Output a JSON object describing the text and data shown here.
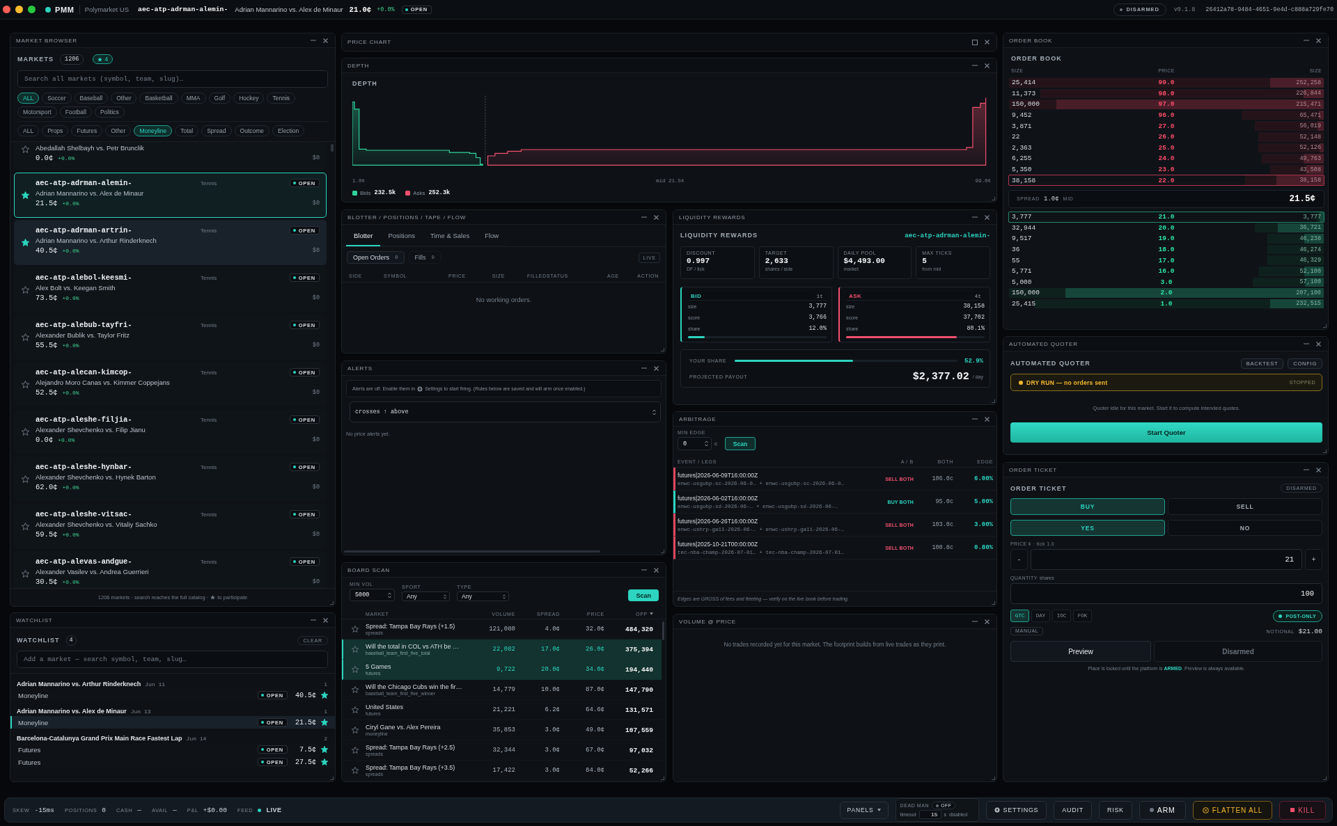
{
  "top_bar": {
    "app_name": "PMM",
    "venue": "Polymarket US",
    "symbol": "aec-atp-adrman-alemin-",
    "title": "Adrian Mannarino vs. Alex de Minaur",
    "price": "21.0¢",
    "change": "+0.0%",
    "status": "OPEN",
    "mode": "DISARMED",
    "version": "v0.1.8",
    "session_id": "26412a78-9484-4651-9e4d-c888a729fe70"
  },
  "market_browser": {
    "title": "MARKET BROWSER",
    "label": "MARKETS",
    "count": "1206",
    "favorites": "4",
    "search": {
      "placeholder": "Search all markets (symbol, team, slug)…"
    },
    "sport_filters": [
      {
        "label": "ALL",
        "selected": true
      },
      {
        "label": "Soccer",
        "selected": false
      },
      {
        "label": "Baseball",
        "selected": false
      },
      {
        "label": "Other",
        "selected": false
      },
      {
        "label": "Basketball",
        "selected": false
      },
      {
        "label": "MMA",
        "selected": false
      },
      {
        "label": "Golf",
        "selected": false
      },
      {
        "label": "Hockey",
        "selected": false
      },
      {
        "label": "Tennis",
        "selected": false
      },
      {
        "label": "Motorsport",
        "selected": false
      },
      {
        "label": "Football",
        "selected": false
      },
      {
        "label": "Politics",
        "selected": false
      }
    ],
    "type_filters": [
      {
        "label": "ALL",
        "selected": false
      },
      {
        "label": "Props",
        "selected": false
      },
      {
        "label": "Futures",
        "selected": false
      },
      {
        "label": "Other",
        "selected": false
      },
      {
        "label": "Moneyline",
        "selected": true
      },
      {
        "label": "Total",
        "selected": false
      },
      {
        "label": "Spread",
        "selected": false
      },
      {
        "label": "Outcome",
        "selected": false
      },
      {
        "label": "Election",
        "selected": false
      }
    ],
    "markets": [
      {
        "title": "Abedallah Shelbayh vs. Petr Brunclik",
        "price": "0.0¢",
        "change": "+0.0%",
        "volume": "$0",
        "starred": false,
        "selected": false,
        "highlighted": false
      },
      {
        "symbol": "aec-atp-adrman-alemin-",
        "sport": "Tennis",
        "status": "OPEN",
        "title": "Adrian Mannarino vs. Alex de Minaur",
        "price": "21.5¢",
        "change": "+0.0%",
        "volume": "$0",
        "starred": true,
        "selected": true,
        "highlighted": false
      },
      {
        "symbol": "aec-atp-adrman-artrin-",
        "sport": "Tennis",
        "status": "OPEN",
        "title": "Adrian Mannarino vs. Arthur Rinderknech",
        "price": "40.5¢",
        "change": "+0.0%",
        "volume": "$0",
        "starred": true,
        "selected": false,
        "highlighted": true
      },
      {
        "symbol": "aec-atp-alebol-keesmi-",
        "sport": "Tennis",
        "status": "OPEN",
        "title": "Alex Bolt vs. Keegan Smith",
        "price": "73.5¢",
        "change": "+0.0%",
        "volume": "$0",
        "starred": false,
        "selected": false,
        "highlighted": false
      },
      {
        "symbol": "aec-atp-alebub-tayfri-",
        "sport": "Tennis",
        "status": "OPEN",
        "title": "Alexander Bublik vs. Taylor Fritz",
        "price": "55.5¢",
        "change": "+0.0%",
        "volume": "$0",
        "starred": false,
        "selected": false,
        "highlighted": false
      },
      {
        "symbol": "aec-atp-alecan-kimcop-",
        "sport": "Tennis",
        "status": "OPEN",
        "title": "Alejandro Moro Canas vs. Kimmer Coppejans",
        "price": "52.5¢",
        "change": "+0.0%",
        "volume": "$0",
        "starred": false,
        "selected": false,
        "highlighted": false
      },
      {
        "symbol": "aec-atp-aleshe-filjia-",
        "sport": "Tennis",
        "status": "OPEN",
        "title": "Alexander Shevchenko vs. Filip Jianu",
        "price": "0.0¢",
        "change": "+0.0%",
        "volume": "$0",
        "starred": false,
        "selected": false,
        "highlighted": false
      },
      {
        "symbol": "aec-atp-aleshe-hynbar-",
        "sport": "Tennis",
        "status": "OPEN",
        "title": "Alexander Shevchenko vs. Hynek Barton",
        "price": "62.0¢",
        "change": "+0.0%",
        "volume": "$0",
        "starred": false,
        "selected": false,
        "highlighted": false
      },
      {
        "symbol": "aec-atp-aleshe-vitsac-",
        "sport": "Tennis",
        "status": "OPEN",
        "title": "Alexander Shevchenko vs. Vitaliy Sachko",
        "price": "59.5¢",
        "change": "+0.0%",
        "volume": "$0",
        "starred": false,
        "selected": false,
        "highlighted": false
      },
      {
        "symbol": "aec-atp-alevas-andgue-",
        "sport": "Tennis",
        "status": "OPEN",
        "title": "Alexander Vasilev vs. Andrea Guerrieri",
        "price": "30.5¢",
        "change": "+0.0%",
        "volume": "$0",
        "starred": false,
        "selected": false,
        "highlighted": false
      }
    ],
    "footer_lead": "1206 markets · search reaches the full catalog ·",
    "footer_tail": "to participate"
  },
  "watchlist": {
    "title": "WATCHLIST",
    "label": "WATCHLIST",
    "count": "4",
    "clear": "CLEAR",
    "search": {
      "placeholder": "Add a market — search symbol, team, slug…"
    },
    "groups": [
      {
        "title": "Adrian Mannarino vs. Arthur Rinderknech",
        "date": "Jun 11",
        "count": "1",
        "items": [
          {
            "type": "Moneyline",
            "status": "OPEN",
            "price": "40.5¢",
            "starred": true,
            "selected": false
          }
        ]
      },
      {
        "title": "Adrian Mannarino vs. Alex de Minaur",
        "date": "Jun 13",
        "count": "1",
        "items": [
          {
            "type": "Moneyline",
            "status": "OPEN",
            "price": "21.5¢",
            "starred": true,
            "selected": true
          }
        ]
      },
      {
        "title": "Barcelona-Catalunya Grand Prix Main Race Fastest Lap",
        "date": "Jun 14",
        "count": "2",
        "items": [
          {
            "type": "Futures",
            "status": "OPEN",
            "price": "7.5¢",
            "starred": true,
            "selected": false
          },
          {
            "type": "Futures",
            "status": "OPEN",
            "price": "27.5¢",
            "starred": true,
            "selected": false
          }
        ]
      }
    ]
  },
  "price_chart": {
    "title": "PRICE CHART",
    "collapsed": true
  },
  "depth": {
    "title": "DEPTH",
    "heading": "DEPTH",
    "axis_low": "1.0¢",
    "axis_mid": "mid 21.5¢",
    "axis_high": "99.0¢",
    "legend": [
      {
        "label": "Bids",
        "value": "232.5k",
        "color": "#2fd39a"
      },
      {
        "label": "Asks",
        "value": "252.3k",
        "color": "#f0506e"
      }
    ]
  },
  "blotter": {
    "title": "BLOTTER / POSITIONS / TAPE / FLOW",
    "tabs": [
      {
        "label": "Blotter",
        "selected": true
      },
      {
        "label": "Positions",
        "selected": false
      },
      {
        "label": "Time & Sales",
        "selected": false
      },
      {
        "label": "Flow",
        "selected": false
      }
    ],
    "subtabs": [
      {
        "label": "Open Orders",
        "count": "0",
        "selected": true
      },
      {
        "label": "Fills",
        "count": "0",
        "selected": false
      }
    ],
    "live": "LIVE",
    "columns": [
      "SIDE",
      "SYMBOL",
      "PRICE",
      "SIZE",
      "FILLED",
      "STATUS",
      "AGE",
      "ACTION"
    ],
    "empty": "No working orders."
  },
  "liquidity_rewards": {
    "title": "LIQUIDITY REWARDS",
    "heading": "LIQUIDITY REWARDS",
    "symbol": "aec-atp-adrman-alemin-",
    "stats": [
      {
        "label": "DISCOUNT",
        "value": "0.997",
        "sub": "DF / tick"
      },
      {
        "label": "TARGET",
        "value": "2,633",
        "sub": "shares / side"
      },
      {
        "label": "DAILY POOL",
        "value": "$4,493.00",
        "sub": "market"
      },
      {
        "label": "MAX TICKS",
        "value": "5",
        "sub": "from mid"
      }
    ],
    "sides": [
      {
        "kind": "bid",
        "label": "BID",
        "ticks": "1t",
        "rows": [
          {
            "label": "size",
            "value": "3,777"
          },
          {
            "label": "score",
            "value": "3,766"
          },
          {
            "label": "share",
            "value": "12.0%"
          }
        ],
        "bar": {
          "level": 0.12
        }
      },
      {
        "kind": "ask",
        "label": "ASK",
        "ticks": "4t",
        "rows": [
          {
            "label": "size",
            "value": "38,158"
          },
          {
            "label": "score",
            "value": "37,702"
          },
          {
            "label": "share",
            "value": "80.1%"
          }
        ],
        "bar": {
          "level": 0.801
        }
      }
    ],
    "your_share": {
      "label": "YOUR SHARE",
      "level": 0.529,
      "value": "52.9%"
    },
    "payout": {
      "label": "PROJECTED PAYOUT",
      "value": "$2,377.02",
      "unit": "/ day"
    }
  },
  "alerts": {
    "title": "ALERTS",
    "notice_lead": "Alerts are off. Enable them in",
    "notice_tail": "Settings to start firing. (Rules below are saved and will arm once enabled.)",
    "rule": "crosses ↑ above",
    "empty": "No price alerts yet."
  },
  "arbitrage": {
    "title": "ARBITRAGE",
    "min_edge_label": "MIN EDGE",
    "min_edge": "0",
    "unit": "c",
    "scan": "Scan",
    "columns": [
      "EVENT / LEGS",
      "A / B",
      "BOTH",
      "EDGE"
    ],
    "rows": [
      {
        "event": "futures|2026-06-09T16:00:00Z",
        "leg_a": "enwc-usgubp-sc-2026-06-0…",
        "leg_b": "+ enwc-usgubp-sc-2026-06-0…",
        "kind": "sell",
        "action": "SELL BOTH",
        "both": "106.0c",
        "edge": "6.00%"
      },
      {
        "event": "futures|2026-06-02T16:00:00Z",
        "leg_a": "enwc-usgubp-sd-2026-06-…",
        "leg_b": "+ enwc-usgubp-sd-2026-06-…",
        "kind": "buy",
        "action": "BUY BOTH",
        "both": "95.0c",
        "edge": "5.00%"
      },
      {
        "event": "futures|2026-06-26T16:00:00Z",
        "leg_a": "enwc-ushrp-ga11-2026-06-…",
        "leg_b": "+ enwc-ushrp-ga11-2026-06-…",
        "kind": "sell",
        "action": "SELL BOTH",
        "both": "103.0c",
        "edge": "3.00%"
      },
      {
        "event": "futures|2025-10-21T00:00:00Z",
        "leg_a": "tec-nba-champ-2026-07-01…",
        "leg_b": "+ tec-nba-champ-2026-07-01…",
        "kind": "sell",
        "action": "SELL BOTH",
        "both": "100.8c",
        "edge": "0.80%"
      }
    ],
    "footer": "Edges are GROSS of fees and fleeting — verify on the live book before trading."
  },
  "board_scan": {
    "title": "BOARD SCAN",
    "filters": [
      {
        "label": "MIN VOL",
        "value": "5000",
        "kind": "number"
      },
      {
        "label": "SPORT",
        "value": "Any",
        "kind": "select"
      },
      {
        "label": "TYPE",
        "value": "Any",
        "kind": "select"
      }
    ],
    "scan": "Scan",
    "columns": [
      {
        "label": "MARKET",
        "sorted": false
      },
      {
        "label": "VOLUME",
        "sorted": false
      },
      {
        "label": "SPREAD",
        "sorted": false
      },
      {
        "label": "PRICE",
        "sorted": false
      },
      {
        "label": "OPP",
        "sorted": true
      }
    ],
    "rows": [
      {
        "title": "Spread: Tampa Bay Rays (+1.5)",
        "category": "spreads",
        "volume": "121,080",
        "spread": "4.0¢",
        "price": "32.0¢",
        "opp": "484,320",
        "starred": false,
        "selected": false
      },
      {
        "title": "Will the total in COL vs ATH be …",
        "category": "baseball_team_first_five_total",
        "volume": "22,082",
        "spread": "17.0¢",
        "price": "26.0¢",
        "opp": "375,394",
        "starred": false,
        "selected": true
      },
      {
        "title": "5 Games",
        "category": "futures",
        "volume": "9,722",
        "spread": "20.0¢",
        "price": "34.0¢",
        "opp": "194,440",
        "starred": false,
        "selected": true
      },
      {
        "title": "Will the Chicago Cubs win the fir…",
        "category": "baseball_team_first_five_winner",
        "volume": "14,779",
        "spread": "10.0¢",
        "price": "87.0¢",
        "opp": "147,790",
        "starred": false,
        "selected": false
      },
      {
        "title": "United States",
        "category": "futures",
        "volume": "21,221",
        "spread": "6.2¢",
        "price": "64.6¢",
        "opp": "131,571",
        "starred": false,
        "selected": false
      },
      {
        "title": "Ciryl Gane vs. Alex Pereira",
        "category": "moneyline",
        "volume": "35,853",
        "spread": "3.0¢",
        "price": "49.0¢",
        "opp": "107,559",
        "starred": false,
        "selected": false
      },
      {
        "title": "Spread: Tampa Bay Rays (+2.5)",
        "category": "spreads",
        "volume": "32,344",
        "spread": "3.0¢",
        "price": "67.0¢",
        "opp": "97,032",
        "starred": false,
        "selected": false
      },
      {
        "title": "Spread: Tampa Bay Rays (+3.5)",
        "category": "spreads",
        "volume": "17,422",
        "spread": "3.0¢",
        "price": "84.0¢",
        "opp": "52,266",
        "starred": false,
        "selected": false
      }
    ]
  },
  "volume_at_price": {
    "title": "VOLUME @ PRICE",
    "empty": "No trades recorded yet for this market. The footprint builds from live trades as they print."
  },
  "order_book": {
    "title": "ORDER BOOK",
    "heading": "ORDER BOOK",
    "columns": [
      "SIZE",
      "PRICE",
      "SIZE"
    ],
    "asks": [
      {
        "size": "25,414",
        "price": "99.0",
        "total": "252,258",
        "best": false,
        "depth_bar": {
          "level": 1.0
        },
        "size_bar": {
          "level": 0.17
        }
      },
      {
        "size": "11,373",
        "price": "98.0",
        "total": "226,844",
        "best": false,
        "depth_bar": {
          "level": 0.9
        },
        "size_bar": {
          "level": 0.064
        }
      },
      {
        "size": "150,000",
        "price": "97.0",
        "total": "215,471",
        "best": false,
        "depth_bar": {
          "level": 1.0
        },
        "size_bar": {
          "level": 0.85
        }
      },
      {
        "size": "9,452",
        "price": "96.0",
        "total": "65,471",
        "best": false,
        "depth_bar": {
          "level": 0.26
        },
        "size_bar": {
          "level": 0.015
        }
      },
      {
        "size": "3,871",
        "price": "27.0",
        "total": "56,019",
        "best": false,
        "depth_bar": {
          "level": 0.22
        },
        "size_bar": {
          "level": 0.02
        }
      },
      {
        "size": "22",
        "price": "26.0",
        "total": "52,148",
        "best": false,
        "depth_bar": {
          "level": 0.207
        }
      },
      {
        "size": "2,363",
        "price": "25.0",
        "total": "52,126",
        "best": false,
        "depth_bar": {
          "level": 0.207
        },
        "size_bar": {
          "level": 0.013
        }
      },
      {
        "size": "6,255",
        "price": "24.0",
        "total": "49,763",
        "best": false,
        "depth_bar": {
          "level": 0.197
        },
        "size_bar": {
          "level": 0.065
        }
      },
      {
        "size": "5,350",
        "price": "23.0",
        "total": "43,508",
        "best": false,
        "depth_bar": {
          "level": 0.17
        },
        "size_bar": {
          "level": 0.055
        }
      },
      {
        "size": "38,158",
        "price": "22.0",
        "total": "38,158",
        "best": true,
        "depth_bar": {
          "level": 0.25
        },
        "size_bar": {
          "level": 0.15
        }
      }
    ],
    "spread": {
      "label": "SPREAD",
      "value": "1.0¢",
      "mid_label": "MID",
      "mid": "21.5¢"
    },
    "bids": [
      {
        "size": "3,777",
        "price": "21.0",
        "total": "3,777",
        "best": true,
        "depth_bar": {
          "level": 0.025
        },
        "size_bar": {
          "level": 0.013
        }
      },
      {
        "size": "32,944",
        "price": "20.0",
        "total": "36,721",
        "best": false,
        "depth_bar": {
          "level": 0.22
        },
        "size_bar": {
          "level": 0.145
        }
      },
      {
        "size": "9,517",
        "price": "19.0",
        "total": "46,238",
        "best": false,
        "depth_bar": {
          "level": 0.18
        },
        "size_bar": {
          "level": 0.063
        }
      },
      {
        "size": "36",
        "price": "18.0",
        "total": "46,274",
        "best": false,
        "depth_bar": {
          "level": 0.18
        }
      },
      {
        "size": "55",
        "price": "17.0",
        "total": "46,329",
        "best": false,
        "depth_bar": {
          "level": 0.18
        }
      },
      {
        "size": "5,771",
        "price": "16.0",
        "total": "52,100",
        "best": false,
        "depth_bar": {
          "level": 0.205
        },
        "size_bar": {
          "level": 0.063
        }
      },
      {
        "size": "5,000",
        "price": "3.0",
        "total": "57,100",
        "best": false,
        "depth_bar": {
          "level": 0.225
        },
        "size_bar": {
          "level": 0.06
        }
      },
      {
        "size": "150,000",
        "price": "2.0",
        "total": "207,100",
        "best": false,
        "depth_bar": {
          "level": 1.0
        },
        "size_bar": {
          "level": 0.82
        }
      },
      {
        "size": "25,415",
        "price": "1.0",
        "total": "232,515",
        "best": false,
        "depth_bar": {
          "level": 0.92
        },
        "size_bar": {
          "level": 0.17
        }
      }
    ]
  },
  "automated_quoter": {
    "title": "AUTOMATED QUOTER",
    "heading": "AUTOMATED QUOTER",
    "buttons": [
      "BACKTEST",
      "CONFIG"
    ],
    "banner": {
      "text": "DRY RUN — no orders sent",
      "state": "STOPPED"
    },
    "idle": "Quoter idle for this market. Start it to compute intended quotes.",
    "start": "Start Quoter"
  },
  "order_ticket": {
    "title": "ORDER TICKET",
    "heading": "ORDER TICKET",
    "mode": "DISARMED",
    "sides": [
      {
        "label": "BUY",
        "selected": true
      },
      {
        "label": "SELL",
        "selected": false
      }
    ],
    "outcomes": [
      {
        "label": "YES",
        "selected": true
      },
      {
        "label": "NO",
        "selected": false
      }
    ],
    "price_label": "PRICE ¢ · tick 1.0",
    "decrement": "-",
    "price": "21",
    "increment": "+",
    "quantity_label": "QUANTITY",
    "quantity_unit": "shares",
    "quantity": "100",
    "tif": [
      {
        "label": "GTC",
        "selected": true
      },
      {
        "label": "DAY",
        "selected": false
      },
      {
        "label": "IOC",
        "selected": false
      },
      {
        "label": "FOK",
        "selected": false
      }
    ],
    "post_only": {
      "label": "POST-ONLY",
      "on": true
    },
    "source": "MANUAL",
    "notional_label": "NOTIONAL",
    "notional": "$21.00",
    "preview": "Preview",
    "place": {
      "label": "Disarmed",
      "disabled": true
    },
    "note": "Place is locked until the platform is **ARMED**. Preview is always available."
  },
  "status_bar": {
    "stats": [
      {
        "label": "SKEW",
        "value": "-15ms"
      },
      {
        "label": "POSITIONS",
        "value": "0"
      },
      {
        "label": "CASH",
        "value": "—"
      },
      {
        "label": "AVAIL",
        "value": "—"
      },
      {
        "label": "P&L",
        "value": "+$0.00"
      }
    ],
    "feed": {
      "label": "FEED",
      "value": "LIVE"
    },
    "panels": "PANELS",
    "dead_man": {
      "label": "DEAD MAN",
      "toggle": "OFF",
      "on": false,
      "timeout_label": "timeout",
      "timeout": "15",
      "unit": "s",
      "status": "disabled"
    },
    "actions": [
      {
        "label": "SETTINGS",
        "kind": "settings"
      },
      {
        "label": "AUDIT",
        "kind": "plain"
      },
      {
        "label": "RISK",
        "kind": "plain"
      },
      {
        "label": "ARM",
        "kind": "arm"
      },
      {
        "label": "FLATTEN ALL",
        "kind": "flatten"
      },
      {
        "label": "KILL",
        "kind": "kill"
      }
    ]
  }
}
